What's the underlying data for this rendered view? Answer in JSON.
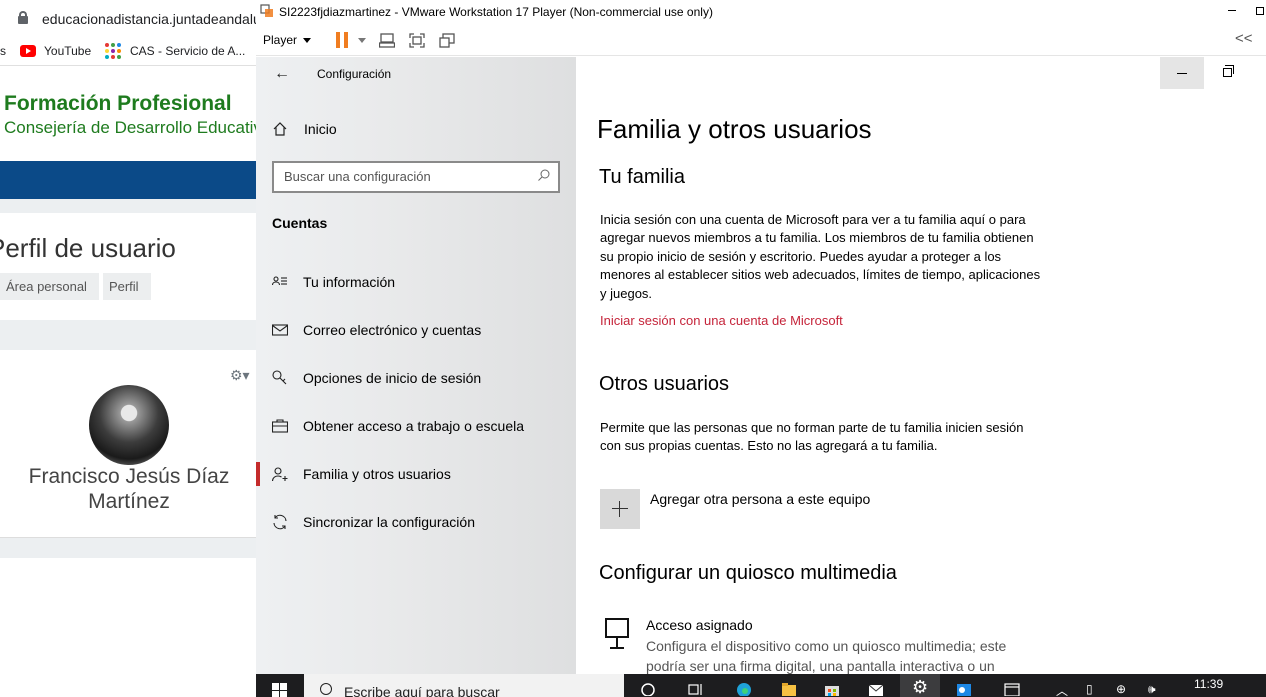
{
  "browser": {
    "url": "educacionadistancia.juntadeandalucia.es",
    "bookmarks": [
      {
        "label": "s"
      },
      {
        "label": "YouTube"
      },
      {
        "label": "CAS - Servicio de A..."
      }
    ],
    "site_title": "Formación Profesional",
    "site_subtitle": "Consejería de Desarrollo Educativo",
    "page_title": "Perfil de usuario",
    "breadcrumbs": [
      "Área personal",
      "Perfil"
    ],
    "user_name": "Francisco Jesús Díaz Martínez"
  },
  "vmware": {
    "title": "SI2223fjdiazmartinez - VMware Workstation 17 Player (Non-commercial use only)",
    "player_menu": "Player",
    "collapse_glyph": "<<"
  },
  "settings": {
    "app_title": "Configuración",
    "home_label": "Inicio",
    "search_placeholder": "Buscar una configuración",
    "section_label": "Cuentas",
    "nav_items": [
      {
        "label": "Tu información",
        "icon": "person-card-icon",
        "active": false
      },
      {
        "label": "Correo electrónico y cuentas",
        "icon": "mail-icon",
        "active": false
      },
      {
        "label": "Opciones de inicio de sesión",
        "icon": "key-icon",
        "active": false
      },
      {
        "label": "Obtener acceso a trabajo o escuela",
        "icon": "briefcase-icon",
        "active": false
      },
      {
        "label": "Familia y otros usuarios",
        "icon": "person-add-icon",
        "active": true
      },
      {
        "label": "Sincronizar la configuración",
        "icon": "sync-icon",
        "active": false
      }
    ],
    "page_title": "Familia y otros usuarios",
    "family": {
      "heading": "Tu familia",
      "text": "Inicia sesión con una cuenta de Microsoft para ver a tu familia aquí o para agregar nuevos miembros a tu familia. Los miembros de tu familia obtienen su propio inicio de sesión y escritorio. Puedes ayudar a proteger a los menores al establecer sitios web adecuados, límites de tiempo, aplicaciones y juegos.",
      "link": "Iniciar sesión con una cuenta de Microsoft"
    },
    "others": {
      "heading": "Otros usuarios",
      "text": "Permite que las personas que no forman parte de tu familia inicien sesión con sus propias cuentas. Esto no las agregará a tu familia.",
      "add_label": "Agregar otra persona a este equipo"
    },
    "kiosk": {
      "heading": "Configurar un quiosco multimedia",
      "item_title": "Acceso asignado",
      "item_desc": "Configura el dispositivo como un quiosco multimedia; este podría ser una firma digital, una pantalla interactiva o un"
    }
  },
  "taskbar": {
    "search_text": "Escribe aquí para buscar",
    "clock": "11:39"
  },
  "colors": {
    "accent_red": "#c42b2b",
    "link_red": "#c5243a",
    "brand_green": "#1e7b1e",
    "brand_blue": "#0b4a88",
    "vm_pause_orange": "#f07d20"
  }
}
